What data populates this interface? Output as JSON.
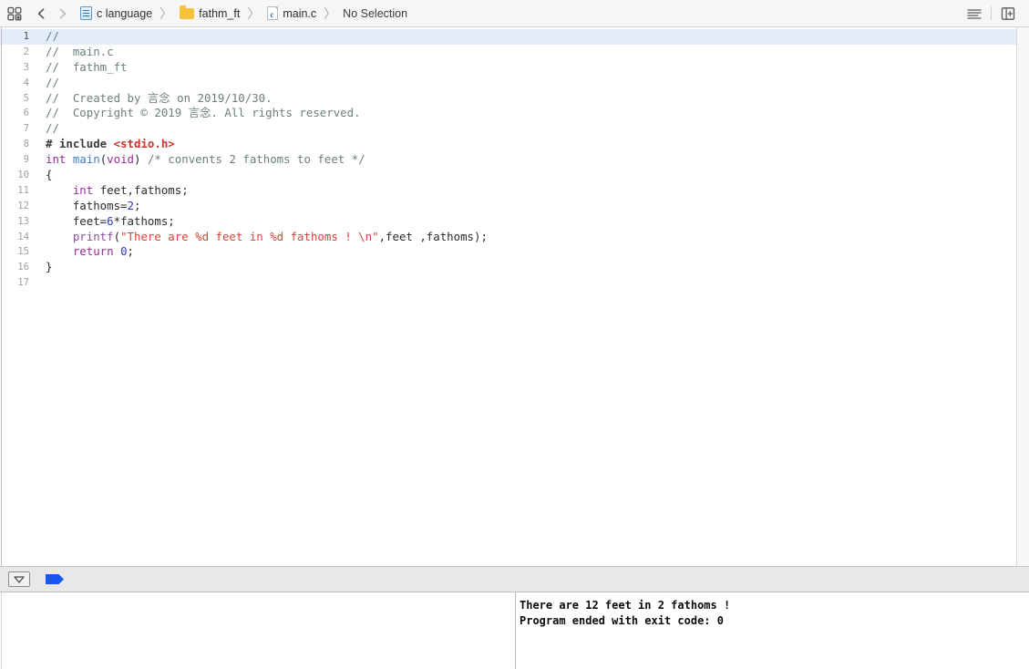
{
  "toolbar": {
    "grid_icon": "grid-squares-icon",
    "back_label": "‹",
    "forward_label": "›",
    "breadcrumb": [
      {
        "icon": "project-icon",
        "label": "c language"
      },
      {
        "icon": "folder-icon",
        "label": "fathm_ft"
      },
      {
        "icon": "c-file-icon",
        "label": "main.c"
      },
      {
        "icon": "",
        "label": "No Selection"
      }
    ],
    "separator": "〉",
    "right_buttons": [
      {
        "name": "editor-options-icon",
        "label": ""
      },
      {
        "name": "add-editor-icon",
        "label": ""
      }
    ]
  },
  "editor": {
    "filename": "main.c",
    "current_line": 1,
    "lines": [
      {
        "n": "1",
        "segments": [
          {
            "cls": "cm",
            "t": "//"
          }
        ]
      },
      {
        "n": "2",
        "segments": [
          {
            "cls": "cm",
            "t": "//  main.c"
          }
        ]
      },
      {
        "n": "3",
        "segments": [
          {
            "cls": "cm",
            "t": "//  fathm_ft"
          }
        ]
      },
      {
        "n": "4",
        "segments": [
          {
            "cls": "cm",
            "t": "//"
          }
        ]
      },
      {
        "n": "5",
        "segments": [
          {
            "cls": "cm",
            "t": "//  Created by 言念 on 2019/10/30."
          }
        ]
      },
      {
        "n": "6",
        "segments": [
          {
            "cls": "cm",
            "t": "//  Copyright © 2019 言念. All rights reserved."
          }
        ]
      },
      {
        "n": "7",
        "segments": [
          {
            "cls": "cm",
            "t": "//"
          }
        ]
      },
      {
        "n": "8",
        "segments": [
          {
            "cls": "pp",
            "t": "# include "
          },
          {
            "cls": "inc",
            "t": "<stdio.h>"
          }
        ]
      },
      {
        "n": "9",
        "segments": [
          {
            "cls": "kw",
            "t": "int"
          },
          {
            "cls": "pl",
            "t": " "
          },
          {
            "cls": "fn",
            "t": "main"
          },
          {
            "cls": "pl",
            "t": "("
          },
          {
            "cls": "kw",
            "t": "void"
          },
          {
            "cls": "pl",
            "t": ") "
          },
          {
            "cls": "cm",
            "t": "/* convents 2 fathoms to feet */"
          }
        ]
      },
      {
        "n": "10",
        "segments": [
          {
            "cls": "pl",
            "t": "{"
          }
        ]
      },
      {
        "n": "11",
        "segments": [
          {
            "cls": "pl",
            "t": "    "
          },
          {
            "cls": "kw",
            "t": "int"
          },
          {
            "cls": "pl",
            "t": " feet,fathoms;"
          }
        ]
      },
      {
        "n": "12",
        "segments": [
          {
            "cls": "pl",
            "t": "    fathoms="
          },
          {
            "cls": "num",
            "t": "2"
          },
          {
            "cls": "pl",
            "t": ";"
          }
        ]
      },
      {
        "n": "13",
        "segments": [
          {
            "cls": "pl",
            "t": "    feet="
          },
          {
            "cls": "num",
            "t": "6"
          },
          {
            "cls": "pl",
            "t": "*fathoms;"
          }
        ]
      },
      {
        "n": "14",
        "segments": [
          {
            "cls": "pl",
            "t": "    "
          },
          {
            "cls": "cal",
            "t": "printf"
          },
          {
            "cls": "pl",
            "t": "("
          },
          {
            "cls": "str",
            "t": "\"There are %d feet in %d fathoms ! \\n\""
          },
          {
            "cls": "pl",
            "t": ",feet ,fathoms);"
          }
        ]
      },
      {
        "n": "15",
        "segments": [
          {
            "cls": "pl",
            "t": "    "
          },
          {
            "cls": "kw",
            "t": "return"
          },
          {
            "cls": "pl",
            "t": " "
          },
          {
            "cls": "num",
            "t": "0"
          },
          {
            "cls": "pl",
            "t": ";"
          }
        ]
      },
      {
        "n": "16",
        "segments": [
          {
            "cls": "pl",
            "t": "}"
          }
        ]
      },
      {
        "n": "17",
        "segments": [
          {
            "cls": "pl",
            "t": ""
          }
        ]
      }
    ]
  },
  "debug_bar": {
    "filter_icon": "scope-filter-icon",
    "flag_icon": "breakpoint-flag-icon"
  },
  "console": {
    "lines": [
      "There are 12 feet in 2 fathoms !",
      "Program ended with exit code: 0"
    ]
  },
  "variables_pane": {
    "content": ""
  }
}
